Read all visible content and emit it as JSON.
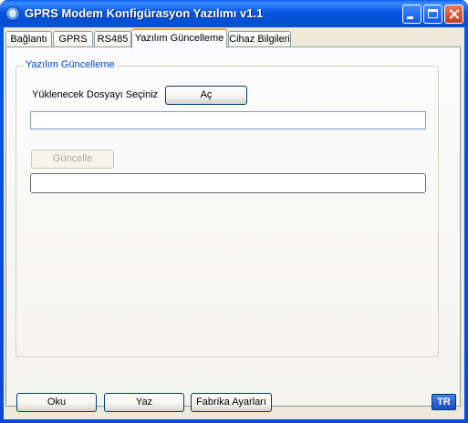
{
  "window": {
    "title": "GPRS Modem Konfigürasyon Yazılımı v1.1",
    "title_color": "#ffffff",
    "titlebar_color": "#0a5cf0"
  },
  "tabs": [
    {
      "label": "Bağlantı",
      "active": false
    },
    {
      "label": "GPRS",
      "active": false
    },
    {
      "label": "RS485",
      "active": false
    },
    {
      "label": "Yazılım Güncelleme",
      "active": true
    },
    {
      "label": "Cihaz Bilgileri",
      "active": false
    }
  ],
  "update_group": {
    "title": "Yazılım Güncelleme",
    "title_color": "#0046d5",
    "select_file_label": "Yüklenecek Dosyayı Seçiniz",
    "open_button": "Aç",
    "file_path_value": "",
    "update_button": "Güncelle",
    "update_button_enabled": false,
    "progress_fraction": 0,
    "progress_color": "#2fb52f"
  },
  "footer": {
    "read_button": "Oku",
    "write_button": "Yaz",
    "factory_button": "Fabrika Ayarları",
    "language_badge": "TR"
  },
  "icons": {
    "app": "satellite-antenna-icon",
    "minimize": "minimize-icon",
    "maximize": "maximize-icon",
    "close": "close-icon"
  }
}
